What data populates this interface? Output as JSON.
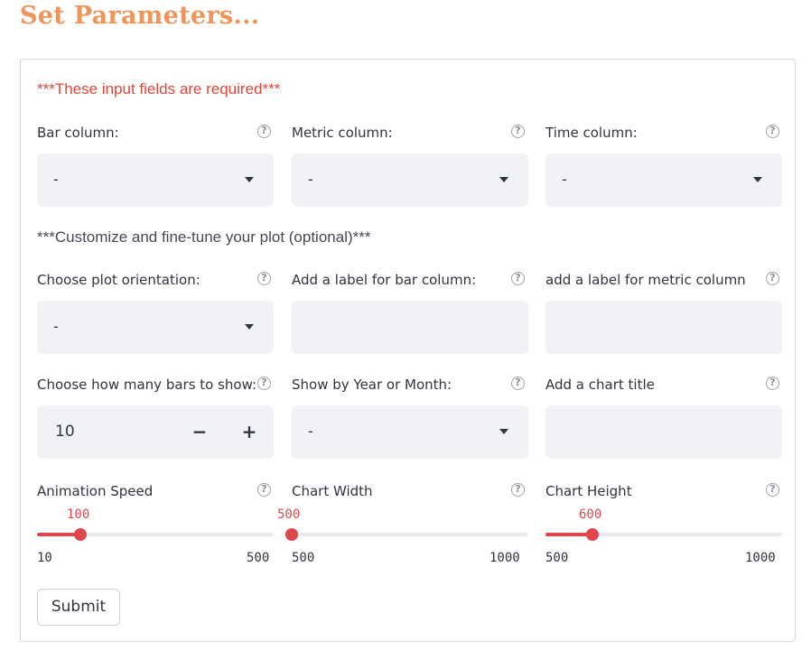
{
  "header": {
    "title": "Set Parameters..."
  },
  "form": {
    "required_note": "***These input fields are required***",
    "optional_note": "***Customize and fine-tune your plot (optional)***",
    "help_glyph": "?",
    "bar_column": {
      "label": "Bar column:",
      "value": "-"
    },
    "metric_column": {
      "label": "Metric column:",
      "value": "-"
    },
    "time_column": {
      "label": "Time column:",
      "value": "-"
    },
    "orientation": {
      "label": "Choose plot orientation:",
      "value": "-"
    },
    "bar_label": {
      "label": "Add a label for bar column:",
      "value": ""
    },
    "metric_label": {
      "label": "add a label for metric column",
      "value": ""
    },
    "bars_to_show": {
      "label": "Choose how many bars to show:",
      "value": "10",
      "minus": "−",
      "plus": "+"
    },
    "year_or_month": {
      "label": "Show by Year or Month:",
      "value": "-"
    },
    "chart_title": {
      "label": "Add a chart title",
      "value": ""
    },
    "animation_speed": {
      "label": "Animation Speed",
      "value": "100",
      "min": "10",
      "max": "500"
    },
    "chart_width": {
      "label": "Chart Width",
      "value": "500",
      "min": "500",
      "max": "1000"
    },
    "chart_height": {
      "label": "Chart Height",
      "value": "600",
      "min": "500",
      "max": "1000"
    },
    "submit_label": "Submit"
  },
  "colors": {
    "title": "#f0955a",
    "required": "#e0453a",
    "slider": "#e0474c",
    "input_bg": "#f0f2f6"
  },
  "icons": {
    "help": "question-circle-icon",
    "dropdown": "caret-down-icon"
  }
}
